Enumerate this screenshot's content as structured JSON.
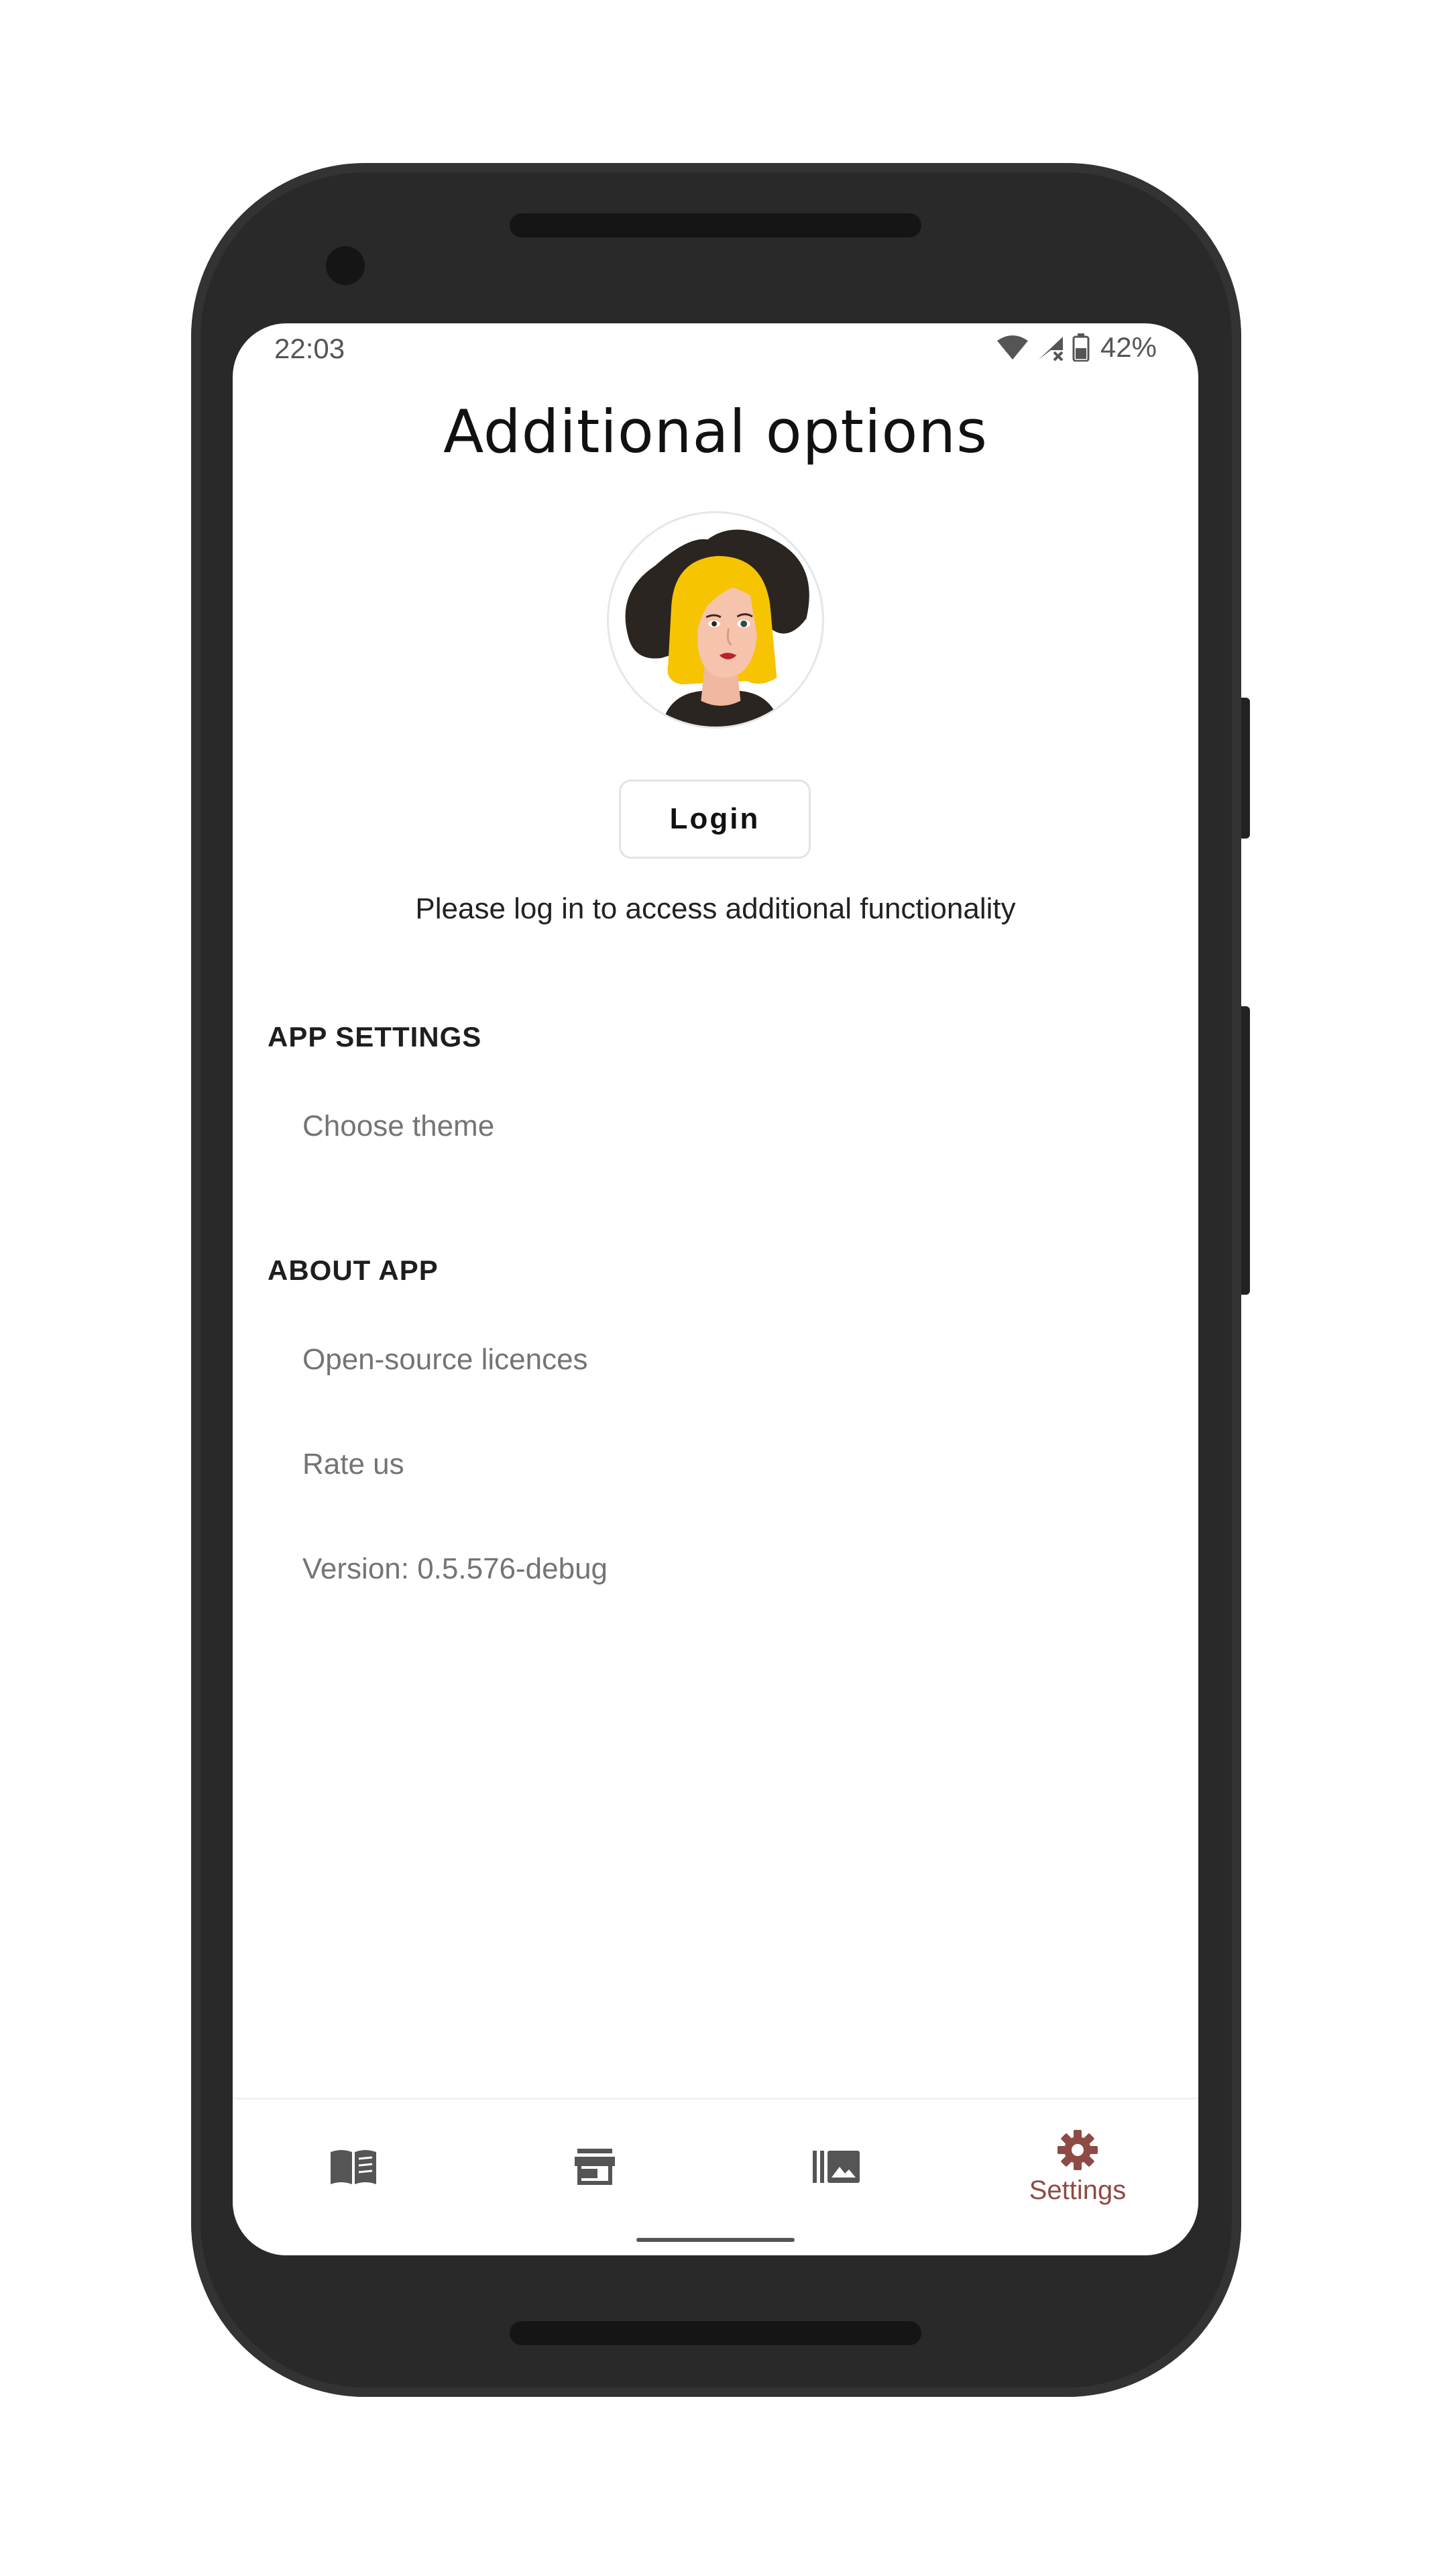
{
  "status_bar": {
    "time": "22:03",
    "battery_percent": "42%",
    "icons": [
      "wifi-icon",
      "signal-off-icon",
      "battery-icon"
    ]
  },
  "header": {
    "title": "Additional options"
  },
  "profile": {
    "avatar_icon": "woman-with-hat-avatar",
    "login_label": "Login",
    "login_hint": "Please log in to access additional functionality"
  },
  "sections": {
    "app_settings": {
      "title": "APP SETTINGS",
      "items": [
        "Choose theme"
      ]
    },
    "about_app": {
      "title": "ABOUT APP",
      "items": [
        "Open-source licences",
        "Rate us",
        "Version: 0.5.576-debug"
      ]
    }
  },
  "bottom_nav": {
    "items": [
      {
        "icon": "book-icon",
        "label": ""
      },
      {
        "icon": "store-icon",
        "label": ""
      },
      {
        "icon": "gallery-icon",
        "label": ""
      },
      {
        "icon": "gear-icon",
        "label": "Settings",
        "selected": true
      }
    ]
  },
  "colors": {
    "accent": "#8e4a45",
    "nav_icon": "#555555",
    "secondary_text": "#747474"
  }
}
